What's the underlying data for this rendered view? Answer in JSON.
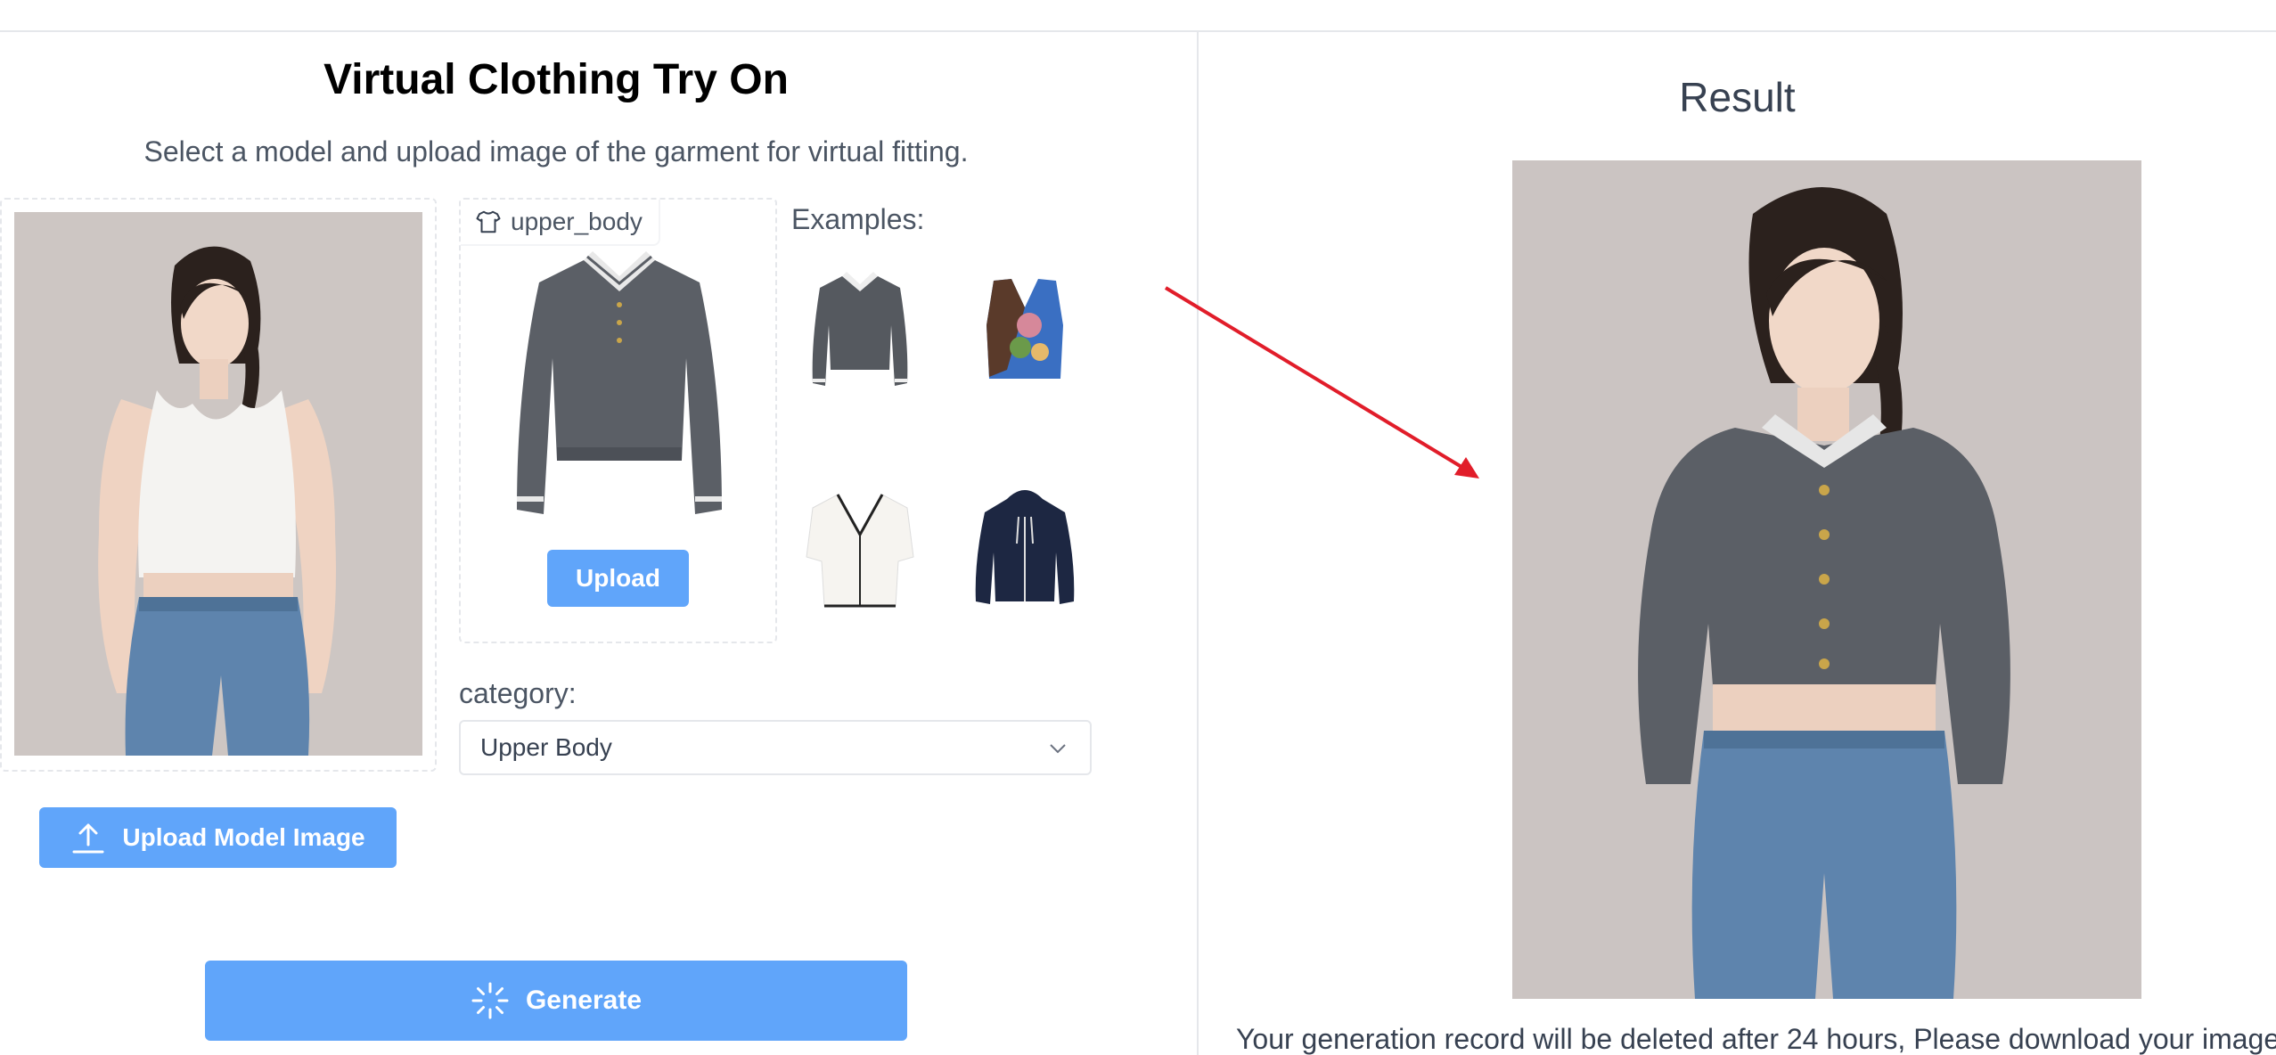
{
  "left": {
    "title": "Virtual Clothing Try On",
    "subtitle": "Select a model and upload image of the garment for virtual fitting.",
    "garment_chip_label": "upper_body",
    "garment_upload_label": "Upload",
    "examples_label": "Examples:",
    "examples": [
      {
        "icon": "gray-polo-sweater"
      },
      {
        "icon": "floral-vest"
      },
      {
        "icon": "white-cardigan"
      },
      {
        "icon": "navy-hoodie"
      }
    ],
    "category_label": "category:",
    "category_value": "Upper Body",
    "upload_model_label": "Upload Model Image",
    "generate_label": "Generate"
  },
  "right": {
    "title": "Result",
    "notice": "Your generation record will be deleted after 24 hours, Please download your image"
  },
  "colors": {
    "accent": "#60a5fa",
    "arrow": "#e11d2a",
    "sweater": "#5b5f66"
  }
}
